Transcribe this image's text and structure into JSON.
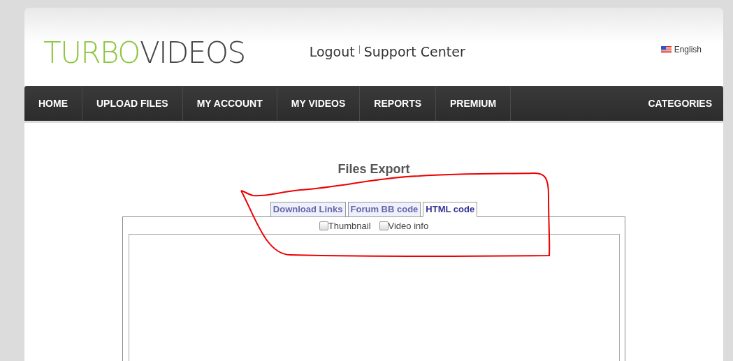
{
  "logo": {
    "part_1": "TURBO",
    "part_2": "VIDEOS"
  },
  "top_links": [
    "Logout",
    "Support Center"
  ],
  "language": "English",
  "nav": {
    "items": [
      {
        "label": "HOME"
      },
      {
        "label": "UPLOAD FILES"
      },
      {
        "label": "MY ACCOUNT"
      },
      {
        "label": "MY VIDEOS"
      },
      {
        "label": "REPORTS"
      },
      {
        "label": "PREMIUM"
      }
    ],
    "right_item": "CATEGORIES"
  },
  "title": "Files Export",
  "tabs": [
    {
      "label": "Download Links",
      "selected": false
    },
    {
      "label": "Forum BB code",
      "selected": false
    },
    {
      "label": "HTML code",
      "selected": true
    }
  ],
  "options": [
    {
      "label": "Thumbnail",
      "checked": false
    },
    {
      "label": "Video info",
      "checked": false
    }
  ]
}
